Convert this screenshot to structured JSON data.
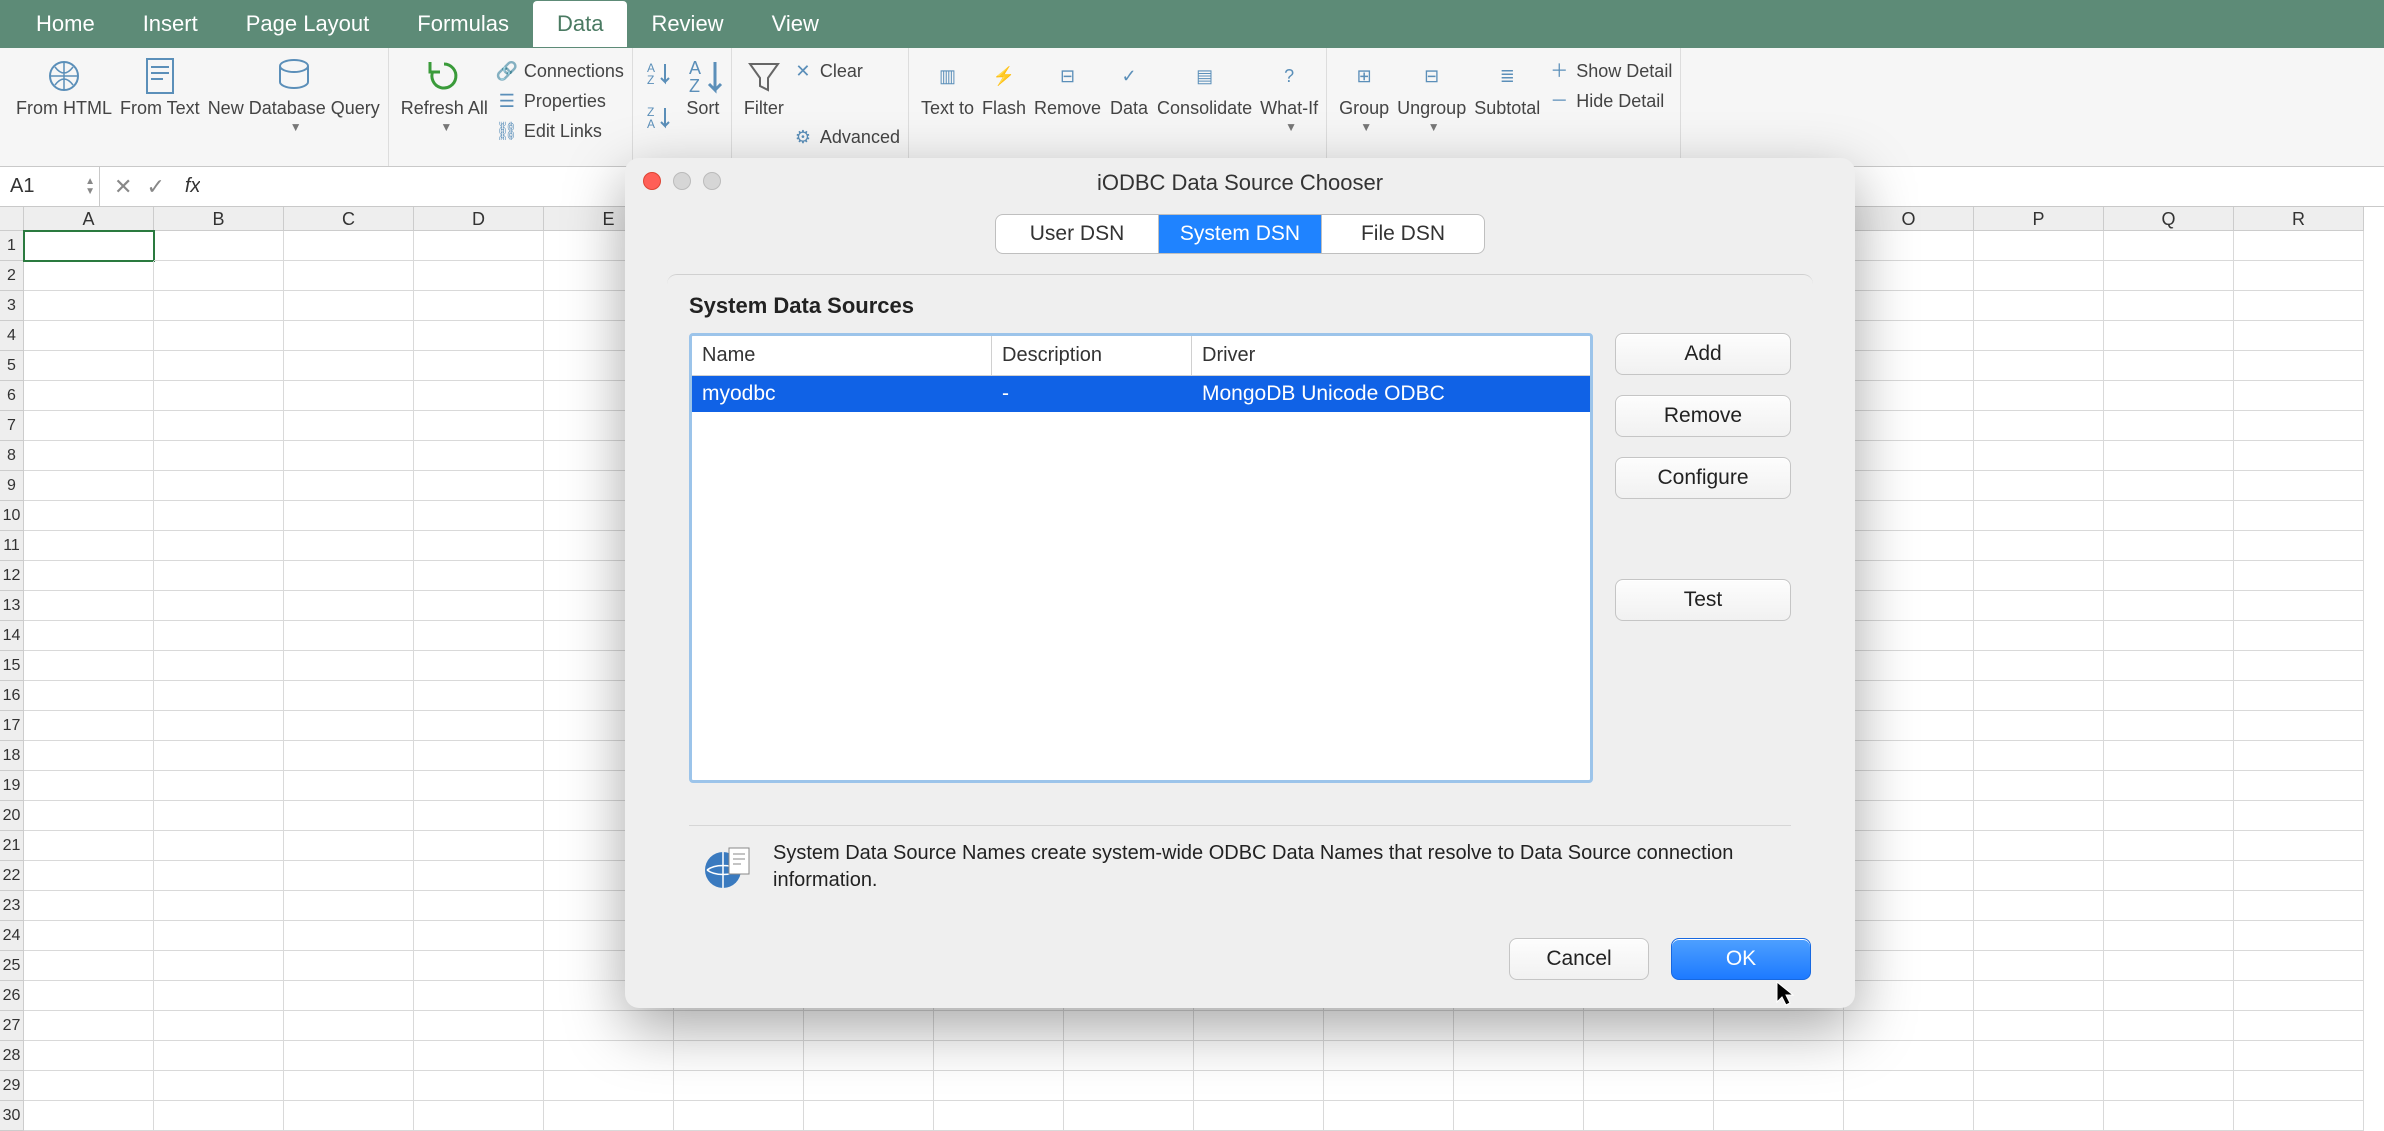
{
  "menu": {
    "items": [
      "Home",
      "Insert",
      "Page Layout",
      "Formulas",
      "Data",
      "Review",
      "View"
    ],
    "active": "Data"
  },
  "ribbon": {
    "from_html": "From HTML",
    "from_text": "From Text",
    "new_db_query": "New Database Query",
    "refresh_all": "Refresh All",
    "connections": "Connections",
    "properties": "Properties",
    "edit_links": "Edit Links",
    "sort": "Sort",
    "filter": "Filter",
    "clear": "Clear",
    "advanced": "Advanced",
    "text_to": "Text to",
    "flash": "Flash",
    "remove": "Remove",
    "data": "Data",
    "consolidate": "Consolidate",
    "what_if": "What-If",
    "group": "Group",
    "ungroup": "Ungroup",
    "subtotal": "Subtotal",
    "show_detail": "Show Detail",
    "hide_detail": "Hide Detail"
  },
  "formula_bar": {
    "cell_ref": "A1",
    "fx": "fx",
    "value": ""
  },
  "sheet": {
    "cols": [
      "A",
      "B",
      "C",
      "D",
      "E",
      "O",
      "P",
      "Q",
      "R"
    ],
    "rows": 25,
    "selected": "A1"
  },
  "dialog": {
    "title": "iODBC Data Source Chooser",
    "tabs": [
      "User DSN",
      "System DSN",
      "File DSN"
    ],
    "active_tab": "System DSN",
    "section_title": "System Data Sources",
    "columns": {
      "name": "Name",
      "description": "Description",
      "driver": "Driver"
    },
    "rows": [
      {
        "name": "myodbc",
        "description": "-",
        "driver": "MongoDB Unicode ODBC",
        "selected": true
      }
    ],
    "buttons": {
      "add": "Add",
      "remove": "Remove",
      "configure": "Configure",
      "test": "Test"
    },
    "info": "System Data Source Names create system-wide ODBC Data Names that resolve to Data Source connection information.",
    "footer": {
      "cancel": "Cancel",
      "ok": "OK"
    }
  }
}
